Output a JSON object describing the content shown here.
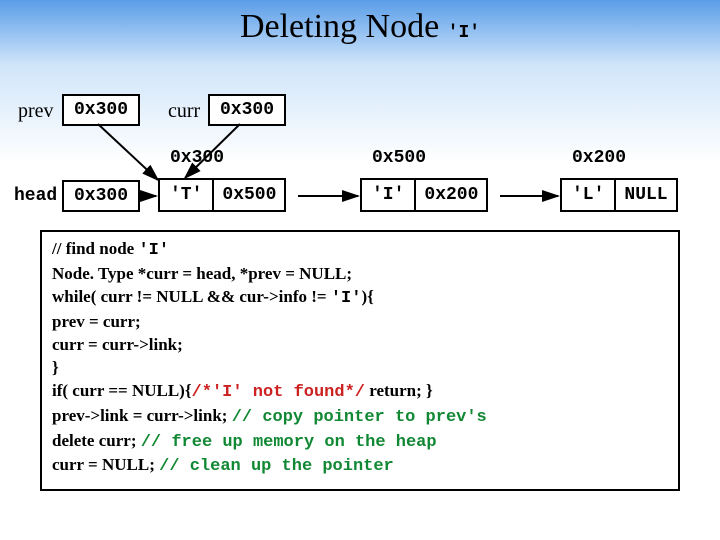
{
  "title_prefix": "Deleting Node ",
  "title_mono": "'I'",
  "pointers": {
    "prev": {
      "label": "prev",
      "value": "0x300"
    },
    "curr": {
      "label": "curr",
      "value": "0x300"
    },
    "head": {
      "label": "head",
      "value": "0x300"
    }
  },
  "nodes": [
    {
      "addr": "0x300",
      "info": "'T'",
      "link": "0x500"
    },
    {
      "addr": "0x500",
      "info": "'I'",
      "link": "0x200"
    },
    {
      "addr": "0x200",
      "info": "'L'",
      "link": "NULL"
    }
  ],
  "code": {
    "l1a": "// find node ",
    "l1b": "'I'",
    "l2": "Node. Type *curr = head, *prev = NULL;",
    "l3a": "while( curr != NULL && cur->info != ",
    "l3b": "'I'",
    "l3c": "){",
    "l4": "  prev = curr;",
    "l5": "  curr = curr->link;",
    "l6": "}",
    "l7a": "if( curr == NULL){",
    "l7b": "/*'I' not found*/",
    "l7c": " return; }",
    "l8a": "prev->link = curr->link; ",
    "l8b": "// copy pointer to prev's",
    "l9a": "delete curr; ",
    "l9b": "// free up memory on the heap",
    "l10a": "curr = NULL; ",
    "l10b": "// clean up the pointer"
  }
}
